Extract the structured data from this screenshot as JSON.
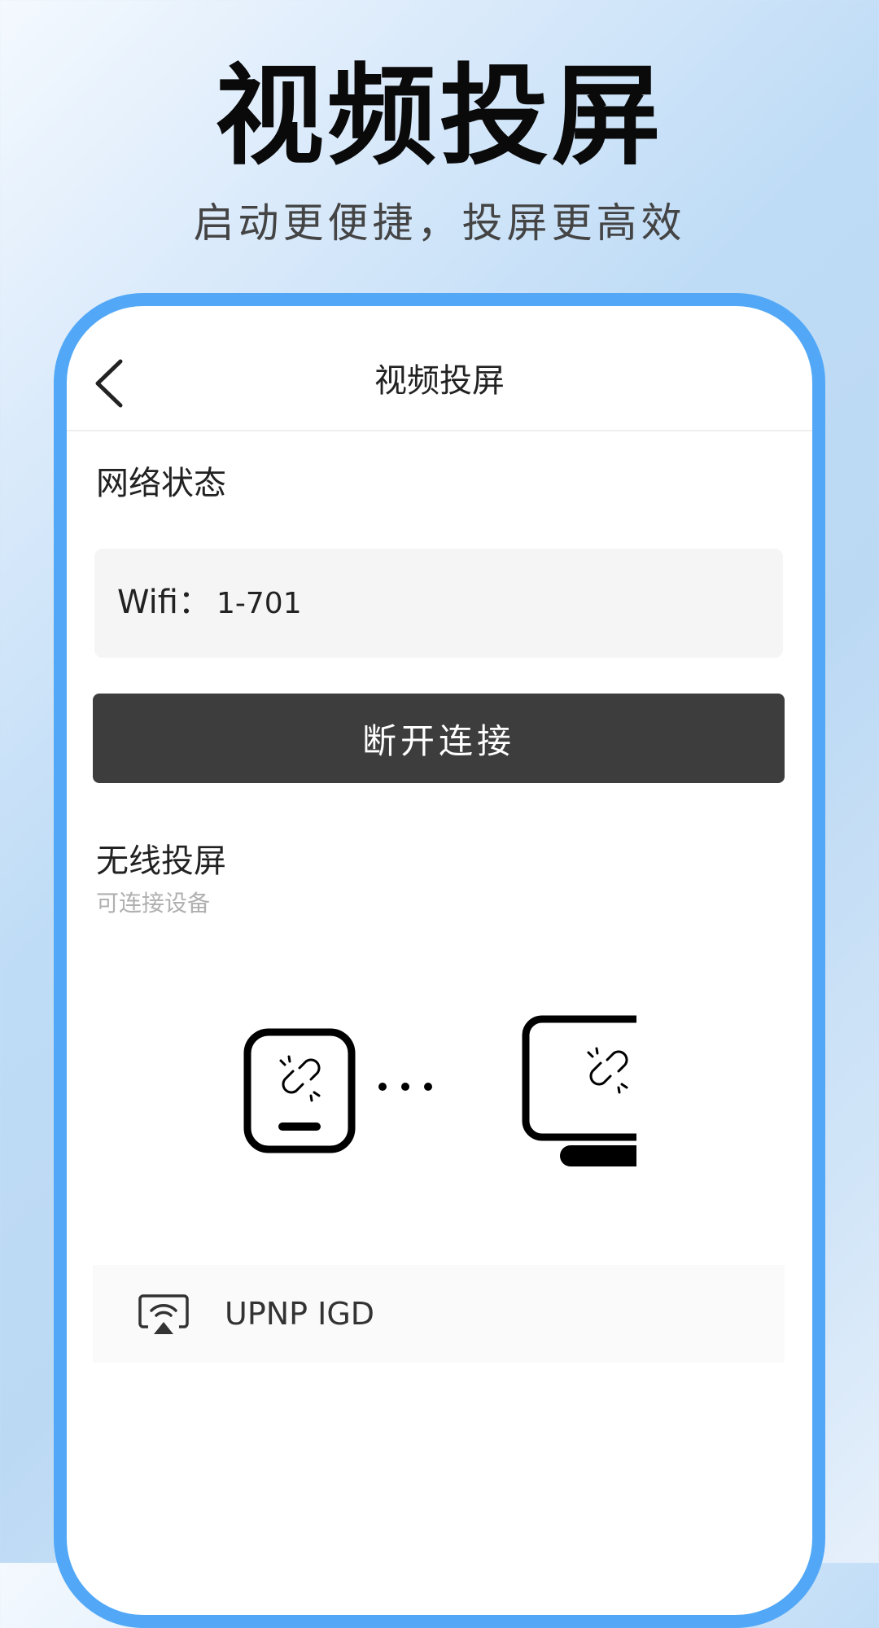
{
  "promo": {
    "title": "视频投屏",
    "subtitle": "启动更便捷，投屏更高效"
  },
  "header": {
    "back_icon": "chevron-left-icon",
    "title": "视频投屏"
  },
  "network": {
    "section_label": "网络状态",
    "wifi_label": "Wifi：",
    "wifi_value": "1-701"
  },
  "disconnect_button_label": "断开连接",
  "wireless": {
    "section_label": "无线投屏",
    "section_sublabel": "可连接设备",
    "illustration_icons": [
      "phone-icon",
      "broken-link-icon",
      "monitor-icon"
    ]
  },
  "devices": [
    {
      "icon": "cast-screen-icon",
      "name": "UPNP IGD"
    }
  ],
  "colors": {
    "frame_border": "#52a8f7",
    "button_background": "#3d3d3d",
    "wifi_box_background": "#f5f5f5"
  }
}
